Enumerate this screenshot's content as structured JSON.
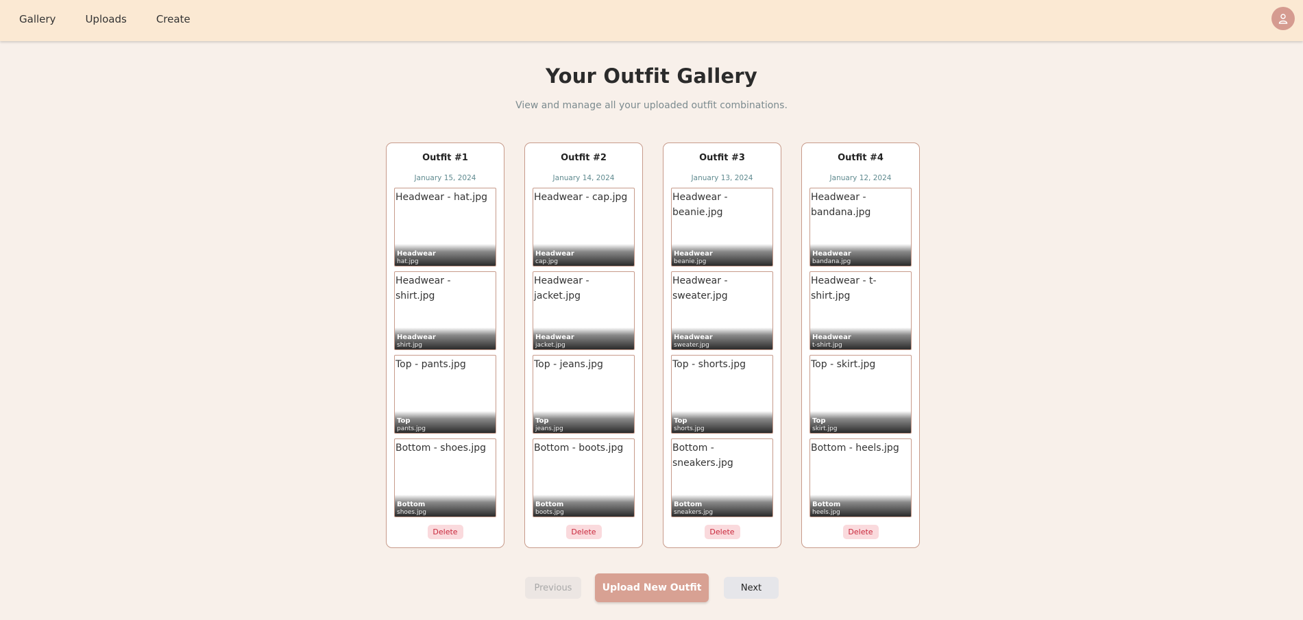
{
  "nav": {
    "links": [
      "Gallery",
      "Uploads",
      "Create"
    ],
    "avatar_icon": "user-icon"
  },
  "header": {
    "title": "Your Outfit Gallery",
    "subtitle": "View and manage all your uploaded outfit combinations."
  },
  "outfits": [
    {
      "title": "Outfit #1",
      "date": "January 15, 2024",
      "items": [
        {
          "alt": "Headwear - hat.jpg",
          "category": "Headwear",
          "file": "hat.jpg"
        },
        {
          "alt": "Headwear - shirt.jpg",
          "category": "Headwear",
          "file": "shirt.jpg"
        },
        {
          "alt": "Top - pants.jpg",
          "category": "Top",
          "file": "pants.jpg"
        },
        {
          "alt": "Bottom - shoes.jpg",
          "category": "Bottom",
          "file": "shoes.jpg"
        }
      ],
      "delete_label": "Delete"
    },
    {
      "title": "Outfit #2",
      "date": "January 14, 2024",
      "items": [
        {
          "alt": "Headwear - cap.jpg",
          "category": "Headwear",
          "file": "cap.jpg"
        },
        {
          "alt": "Headwear - jacket.jpg",
          "category": "Headwear",
          "file": "jacket.jpg"
        },
        {
          "alt": "Top - jeans.jpg",
          "category": "Top",
          "file": "jeans.jpg"
        },
        {
          "alt": "Bottom - boots.jpg",
          "category": "Bottom",
          "file": "boots.jpg"
        }
      ],
      "delete_label": "Delete"
    },
    {
      "title": "Outfit #3",
      "date": "January 13, 2024",
      "items": [
        {
          "alt": "Headwear - beanie.jpg",
          "category": "Headwear",
          "file": "beanie.jpg"
        },
        {
          "alt": "Headwear - sweater.jpg",
          "category": "Headwear",
          "file": "sweater.jpg"
        },
        {
          "alt": "Top - shorts.jpg",
          "category": "Top",
          "file": "shorts.jpg"
        },
        {
          "alt": "Bottom - sneakers.jpg",
          "category": "Bottom",
          "file": "sneakers.jpg"
        }
      ],
      "delete_label": "Delete"
    },
    {
      "title": "Outfit #4",
      "date": "January 12, 2024",
      "items": [
        {
          "alt": "Headwear - bandana.jpg",
          "category": "Headwear",
          "file": "bandana.jpg"
        },
        {
          "alt": "Headwear - t-shirt.jpg",
          "category": "Headwear",
          "file": "t-shirt.jpg"
        },
        {
          "alt": "Top - skirt.jpg",
          "category": "Top",
          "file": "skirt.jpg"
        },
        {
          "alt": "Bottom - heels.jpg",
          "category": "Bottom",
          "file": "heels.jpg"
        }
      ],
      "delete_label": "Delete"
    }
  ],
  "pager": {
    "previous_label": "Previous",
    "upload_label": "Upload New Outfit",
    "next_label": "Next"
  },
  "colors": {
    "page_bg": "#f8f0ea",
    "navbar_bg": "#fbe9d3",
    "accent": "#d8a193",
    "delete_text": "#c8273b"
  }
}
